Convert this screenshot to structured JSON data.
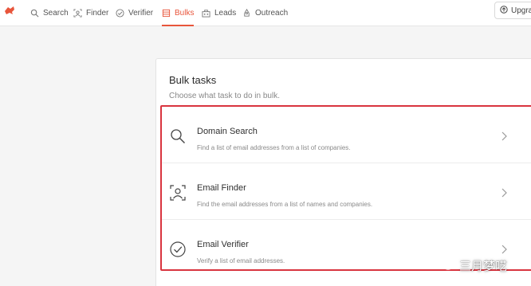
{
  "nav": {
    "items": [
      {
        "label": "Search",
        "icon": "search-icon",
        "active": false
      },
      {
        "label": "Finder",
        "icon": "finder-icon",
        "active": false
      },
      {
        "label": "Verifier",
        "icon": "verifier-icon",
        "active": false
      },
      {
        "label": "Bulks",
        "icon": "bulks-icon",
        "active": true
      },
      {
        "label": "Leads",
        "icon": "leads-icon",
        "active": false
      },
      {
        "label": "Outreach",
        "icon": "outreach-icon",
        "active": false
      }
    ],
    "upgrade_label": "Upgra"
  },
  "card": {
    "title": "Bulk tasks",
    "subtitle": "Choose what task to do in bulk.",
    "tasks": [
      {
        "name": "Domain Search",
        "description": "Find a list of email addresses from a list of companies.",
        "icon": "search-icon"
      },
      {
        "name": "Email Finder",
        "description": "Find the email addresses from a list of names and companies.",
        "icon": "person-scan-icon"
      },
      {
        "name": "Email Verifier",
        "description": "Verify a list of email addresses.",
        "icon": "check-circle-icon"
      }
    ]
  },
  "watermark": {
    "text": "三月梦呓"
  },
  "colors": {
    "accent": "#e8553b",
    "highlight_border": "#d9343f",
    "background": "#f5f5f5"
  }
}
